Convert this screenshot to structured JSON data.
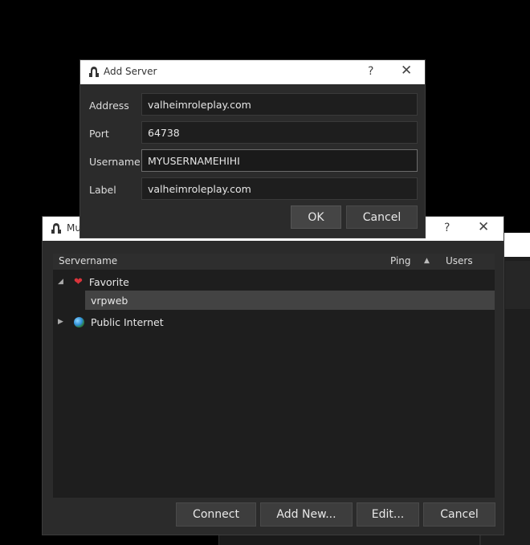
{
  "background": {
    "title_fragment": "Mu"
  },
  "connect_window": {
    "title": "Mu",
    "help_label": "?",
    "close_label": "✕",
    "columns": {
      "servername": "Servername",
      "ping": "Ping",
      "users": "Users"
    },
    "groups": [
      {
        "label": "Favorite",
        "icon": "heart-icon",
        "expanded": true,
        "children": [
          "vrpweb"
        ]
      },
      {
        "label": "Public Internet",
        "icon": "globe-icon",
        "expanded": false
      }
    ],
    "buttons": {
      "connect": "Connect",
      "add_new": "Add New...",
      "edit": "Edit...",
      "cancel": "Cancel"
    }
  },
  "add_server_dialog": {
    "title": "Add Server",
    "help_label": "?",
    "close_label": "✕",
    "fields": {
      "address": {
        "label": "Address",
        "value": "valheimroleplay.com"
      },
      "port": {
        "label": "Port",
        "value": "64738"
      },
      "username": {
        "label": "Username",
        "value": "MYUSERNAMEHIHI"
      },
      "label": {
        "label": "Label",
        "value": "valheimroleplay.com"
      }
    },
    "buttons": {
      "ok": "OK",
      "cancel": "Cancel"
    }
  },
  "colors": {
    "favorite_heart": "#d9343b",
    "selected_row": "#434343",
    "window_bg": "#2b2b2b"
  }
}
